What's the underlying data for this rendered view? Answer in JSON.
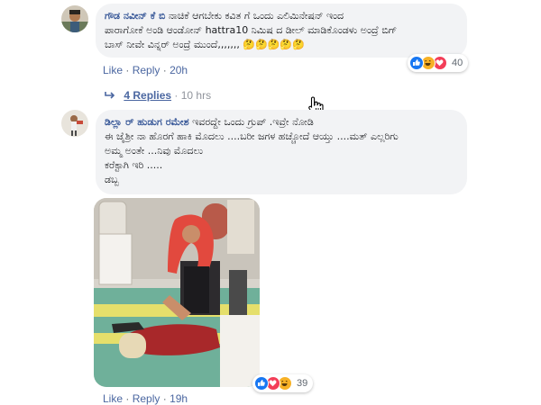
{
  "comments": [
    {
      "author": "ಗೌಡ ನವೀನ್ ಕೆ ಬಿ",
      "lines": [
        "ನಾಚಿಕೆ ಆಗಬೇಕು ಕವಿತ ಗೆ ಒಂದು ಎಲಿಮಿನೇಷನ್ ಇಂದ",
        "ಪಾರಾಗೋಕೆ ಅಂಡಿ ಆಂಡೋನ್ hattra10 ನಿಮಿಷ ದ ಡೀಲ್ ಮಾಡಿಕೊಂಡಳು ಅಂದ್ರೆ ಬಿಗ್",
        "ಬಾಸ್ ನೀವೇ ವಿನ್ನರ್ ಅಂದ್ರೆ ಮುಂದೆ,,,,,,, 🤔🤔🤔🤔🤔"
      ],
      "actions": {
        "like": "Like",
        "sep": "·",
        "reply": "Reply",
        "time": "20h"
      },
      "reactions": {
        "icons": [
          "like",
          "haha",
          "love"
        ],
        "count": "40"
      },
      "replies": {
        "icon": "reply-arrow-icon",
        "label": "4 Replies",
        "sep": "·",
        "time": "10 hrs"
      }
    },
    {
      "author": "ಡಿಲ್ಲಾ ರ್ ಹುಡುಗ ರಮೇಶ",
      "lines": [
        "ಇವರದ್ದೇ ಒಂದು ಗ್ರುಪ್ .ಇವ್ರೇ ನೋಡಿ",
        "ಈ ಜೈಶ್ರೀ ನಾ ಹೊರಗೆ ಹಾಕಿ ಮೊದಲು ....ಬರೀ ಜಗಳ ಹಚ್ಚೋದೆ ಆಯ್ತು ....ಮತ್ ಎಲ್ಲರಿಗು",
        "ಅಮ್ಮ ಅಂತೇ ...ನಿವು ಮೊದಲು",
        "ಕರೆಕ್ಟಾಗಿ ಇರಿ .....",
        "ಡಬ್ಬ"
      ],
      "actions": {
        "like": "Like",
        "sep": "·",
        "reply": "Reply",
        "time": "19h"
      },
      "reactions": {
        "icons": [
          "like",
          "love",
          "haha"
        ],
        "count": "39"
      }
    }
  ],
  "colors": {
    "link": "#4b67a1",
    "author": "#385898",
    "bubble": "#f2f3f5",
    "like": "#1877f2",
    "love": "#f33e58",
    "haha": "#f7b125"
  }
}
